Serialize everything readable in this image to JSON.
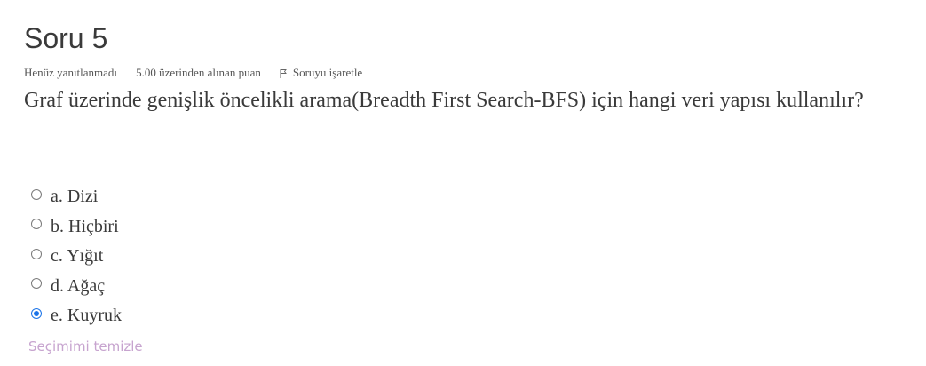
{
  "question": {
    "title": "Soru 5",
    "state": "Henüz yanıtlanmadı",
    "grade": "5.00 üzerinden alınan puan",
    "flag_label": "Soruyu işaretle",
    "text": "Graf üzerinde genişlik öncelikli arama(Breadth First Search-BFS) için hangi veri yapısı kullanılır?"
  },
  "answers": [
    {
      "label": "a. Dizi",
      "checked": false
    },
    {
      "label": "b. Hiçbiri",
      "checked": false
    },
    {
      "label": "c. Yığıt",
      "checked": false
    },
    {
      "label": "d. Ağaç",
      "checked": false
    },
    {
      "label": "e. Kuyruk",
      "checked": true
    }
  ],
  "clear_choice": "Seçimimi temizle",
  "icons": {
    "flag": "flag-icon"
  },
  "colors": {
    "accent": "#1a73e8",
    "link": "#c7a4cf",
    "text": "#3a3a3a"
  }
}
